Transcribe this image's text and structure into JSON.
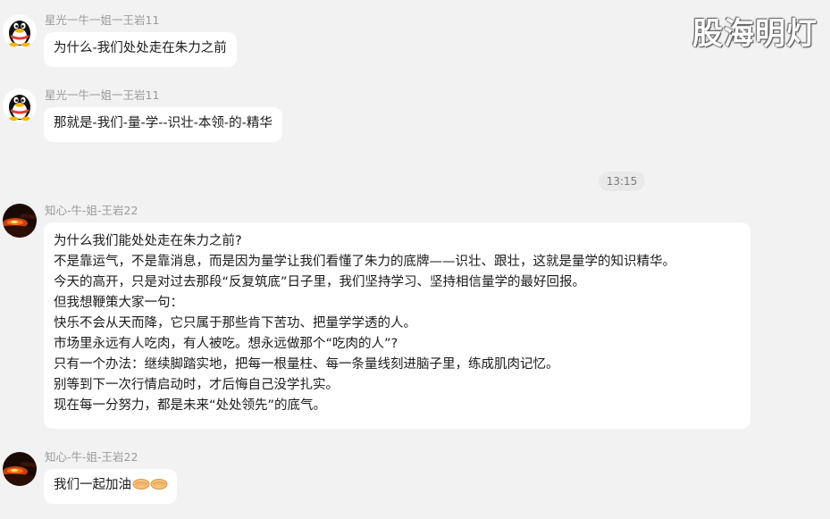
{
  "watermark": "股海明灯",
  "timestamp": "13:15",
  "messages": [
    {
      "sender": "星光一牛一姐一王岩11",
      "avatar_icon": "qq-penguin-icon",
      "lines": [
        "为什么-我们处处走在朱力之前"
      ]
    },
    {
      "sender": "星光一牛一姐一王岩11",
      "avatar_icon": "qq-penguin-icon",
      "lines": [
        "那就是-我们-量-学--识壮-本领-的-精华"
      ]
    },
    {
      "sender": "知心-牛-姐-王岩22",
      "avatar_icon": "sunset-landscape-icon",
      "lines": [
        "为什么我们能处处走在朱力之前?",
        "不是靠运气，不是靠消息，而是因为量学让我们看懂了朱力的底牌——识壮、跟壮，这就是量学的知识精华。",
        "今天的高开，只是对过去那段“反复筑底”日子里，我们坚持学习、坚持相信量学的最好回报。",
        "但我想鞭策大家一句：",
        "快乐不会从天而降，它只属于那些肯下苦功、把量学学透的人。",
        "市场里永远有人吃肉，有人被吃。想永远做那个“吃肉的人”?",
        "只有一个办法：继续脚踏实地，把每一根量柱、每一条量线刻进脑子里，练成肌肉记忆。",
        "别等到下一次行情启动时，才后悔自己没学扎实。",
        "现在每一分努力，都是未来“处处领先”的底气。"
      ]
    },
    {
      "sender": "知心-牛-姐-王岩22",
      "avatar_icon": "sunset-landscape-icon",
      "lines": [
        "我们一起加油"
      ],
      "emoji": "handshake-emoji-icon"
    }
  ]
}
